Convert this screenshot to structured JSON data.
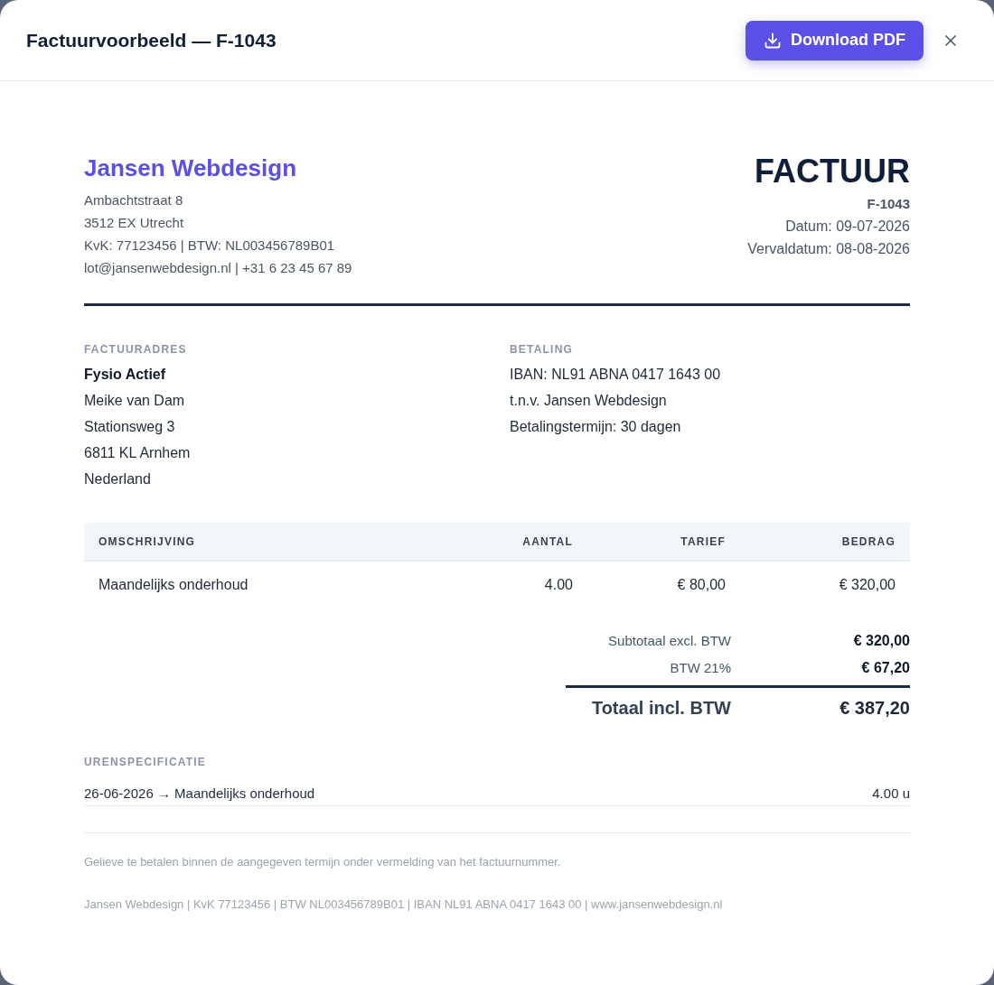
{
  "dialog": {
    "title": "Factuurvoorbeeld — F-1043",
    "download_button": {
      "label": "Download PDF"
    }
  },
  "invoice": {
    "sender": {
      "name": "Jansen Webdesign",
      "lines": [
        "Ambachtstraat 8",
        "3512 EX Utrecht",
        "KvK: 77123456 | BTW: NL003456789B01",
        "lot@jansenwebdesign.nl | +31 6 23 45 67 89"
      ]
    },
    "heading": {
      "title": "FACTUUR",
      "number": "F-1043",
      "date": "Datum: 09-07-2026",
      "due_date": "Vervaldatum: 08-08-2026"
    },
    "bill_to": {
      "label": "FACTUURADRES",
      "name": "Fysio Actief",
      "lines": [
        "Meike van Dam",
        "Stationsweg 3",
        "6811 KL Arnhem",
        "Nederland"
      ]
    },
    "payment": {
      "label": "BETALING",
      "lines": [
        "IBAN: NL91 ABNA 0417 1643 00",
        "t.n.v. Jansen Webdesign",
        "Betalingstermijn: 30 dagen"
      ]
    },
    "table": {
      "columns": [
        "OMSCHRIJVING",
        "AANTAL",
        "TARIEF",
        "BEDRAG"
      ],
      "rows": [
        [
          "Maandelijks onderhoud",
          "4.00",
          "€ 80,00",
          "€ 320,00"
        ]
      ]
    },
    "totals": [
      {
        "kind": "line",
        "label": "Subtotaal excl. BTW",
        "value": "€ 320,00"
      },
      {
        "kind": "line",
        "label": "BTW 21%",
        "value": "€ 67,20"
      },
      {
        "kind": "total",
        "label": "Totaal incl. BTW",
        "value": "€ 387,20"
      }
    ],
    "hours": {
      "label": "URENSPECIFICATIE",
      "entries": [
        {
          "description": "26-06-2026 → Maandelijks onderhoud",
          "amount": "4.00 u"
        }
      ]
    },
    "note": "Gelieve te betalen binnen de aangegeven termijn onder vermelding van het factuurnummer.",
    "footer": "Jansen Webdesign | KvK 77123456 | BTW NL003456789B01 | IBAN NL91 ABNA 0417 1643 00 | www.jansenwebdesign.nl"
  }
}
